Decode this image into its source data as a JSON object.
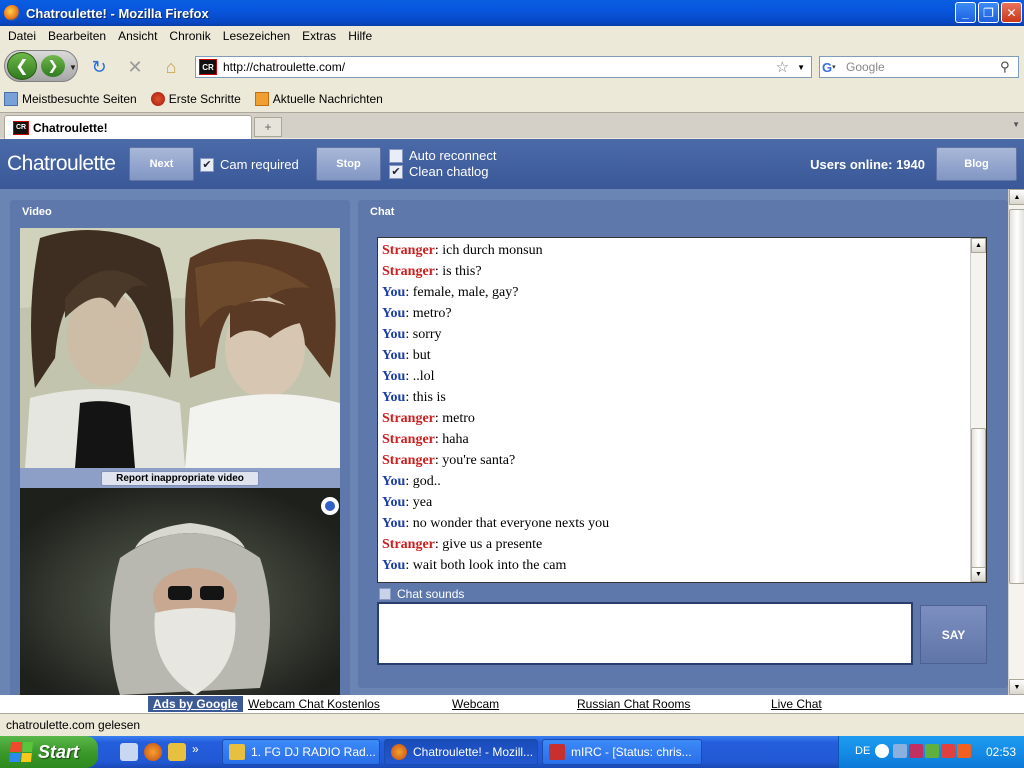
{
  "window": {
    "title": "Chatroulette! - Mozilla Firefox"
  },
  "menu": [
    "Datei",
    "Bearbeiten",
    "Ansicht",
    "Chronik",
    "Lesezeichen",
    "Extras",
    "Hilfe"
  ],
  "nav": {
    "url": "http://chatroulette.com/",
    "search_placeholder": "Google"
  },
  "bookmarks": [
    "Meistbesuchte Seiten",
    "Erste Schritte",
    "Aktuelle Nachrichten"
  ],
  "tab": {
    "label": "Chatroulette!",
    "favicon": "CR"
  },
  "app": {
    "logo": "Chatroulette",
    "next_label": "Next",
    "cam_required_label": "Cam required",
    "stop_label": "Stop",
    "auto_reconnect_label": "Auto reconnect",
    "clean_chatlog_label": "Clean chatlog",
    "users_online": "Users online: 1940",
    "blog_label": "Blog",
    "video_title": "Video",
    "report_label": "Report inappropriate video",
    "chat_title": "Chat",
    "chat_sounds_label": "Chat sounds",
    "say_label": "SAY",
    "cam_required_checked": true,
    "auto_reconnect_checked": false,
    "clean_chatlog_checked": true,
    "chat_sounds_checked": false
  },
  "chat": {
    "lines": [
      {
        "speaker": "Stranger",
        "text": "ich durch monsun"
      },
      {
        "speaker": "Stranger",
        "text": "is this?"
      },
      {
        "speaker": "You",
        "text": "female, male, gay?"
      },
      {
        "speaker": "You",
        "text": "metro?"
      },
      {
        "speaker": "You",
        "text": "sorry"
      },
      {
        "speaker": "You",
        "text": "but"
      },
      {
        "speaker": "You",
        "text": "..lol"
      },
      {
        "speaker": "You",
        "text": "this is"
      },
      {
        "speaker": "Stranger",
        "text": "metro"
      },
      {
        "speaker": "Stranger",
        "text": "haha"
      },
      {
        "speaker": "Stranger",
        "text": "you're santa?"
      },
      {
        "speaker": "You",
        "text": "god.."
      },
      {
        "speaker": "You",
        "text": "yea"
      },
      {
        "speaker": "You",
        "text": "no wonder that everyone nexts you"
      },
      {
        "speaker": "Stranger",
        "text": "give us a presente"
      },
      {
        "speaker": "You",
        "text": "wait both look into the cam"
      }
    ],
    "speaker_colors": {
      "Stranger": "#cc1f1f",
      "You": "#1b3fa4"
    }
  },
  "ads": {
    "badge": "Ads by Google",
    "links": [
      "Webcam Chat Kostenlos",
      "Webcam",
      "Russian Chat Rooms",
      "Live Chat"
    ]
  },
  "status": "chatroulette.com gelesen",
  "taskbar": {
    "start_label": "Start",
    "tasks": [
      "1. FG DJ RADIO Rad...",
      "Chatroulette! - Mozill...",
      "mIRC - [Status: chris..."
    ],
    "language": "DE",
    "clock": "02:53"
  }
}
